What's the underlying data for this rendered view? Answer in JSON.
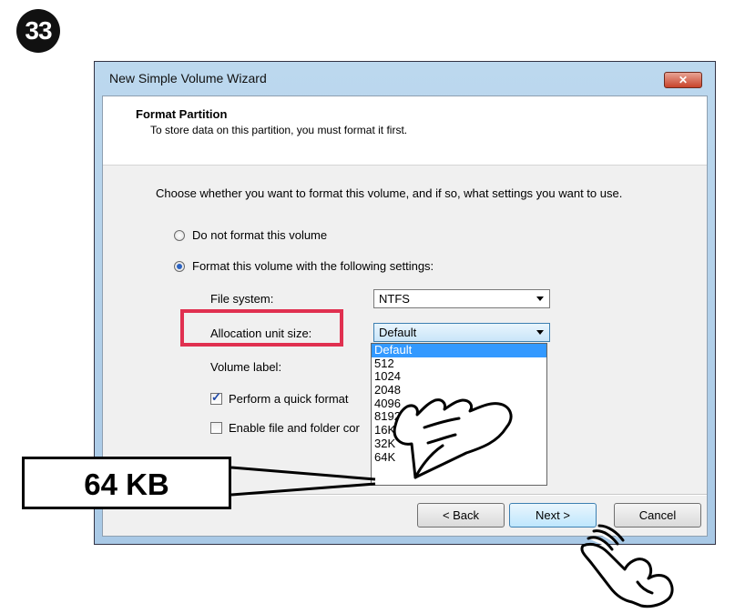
{
  "step_number": "33",
  "dialog": {
    "title": "New Simple Volume Wizard",
    "close_glyph": "✕",
    "header_title": "Format Partition",
    "header_subtitle": "To store data on this partition, you must format it first.",
    "instruction": "Choose whether you want to format this volume, and if so, what settings you want to use.",
    "radio_no_format": "Do not format this volume",
    "radio_format": "Format this volume with the following settings:",
    "file_system_label": "File system:",
    "file_system_value": "NTFS",
    "allocation_label": "Allocation unit size:",
    "allocation_value": "Default",
    "volume_label_label": "Volume label:",
    "quick_format_label": "Perform a quick format",
    "compression_label": "Enable file and folder cor",
    "back_button": "< Back",
    "next_button": "Next >",
    "cancel_button": "Cancel"
  },
  "allocation_options": [
    "Default",
    "512",
    "1024",
    "2048",
    "4096",
    "8192",
    "16K",
    "32K",
    "64K"
  ],
  "callout_text": "64 KB",
  "colors": {
    "highlight_box": "#e03050",
    "selected_item": "#3399ff",
    "close_button": "#c8432a"
  },
  "icons": [
    "hand-pointer-icon",
    "hand-click-icon",
    "check-icon",
    "dropdown-arrow-icon",
    "close-icon"
  ]
}
